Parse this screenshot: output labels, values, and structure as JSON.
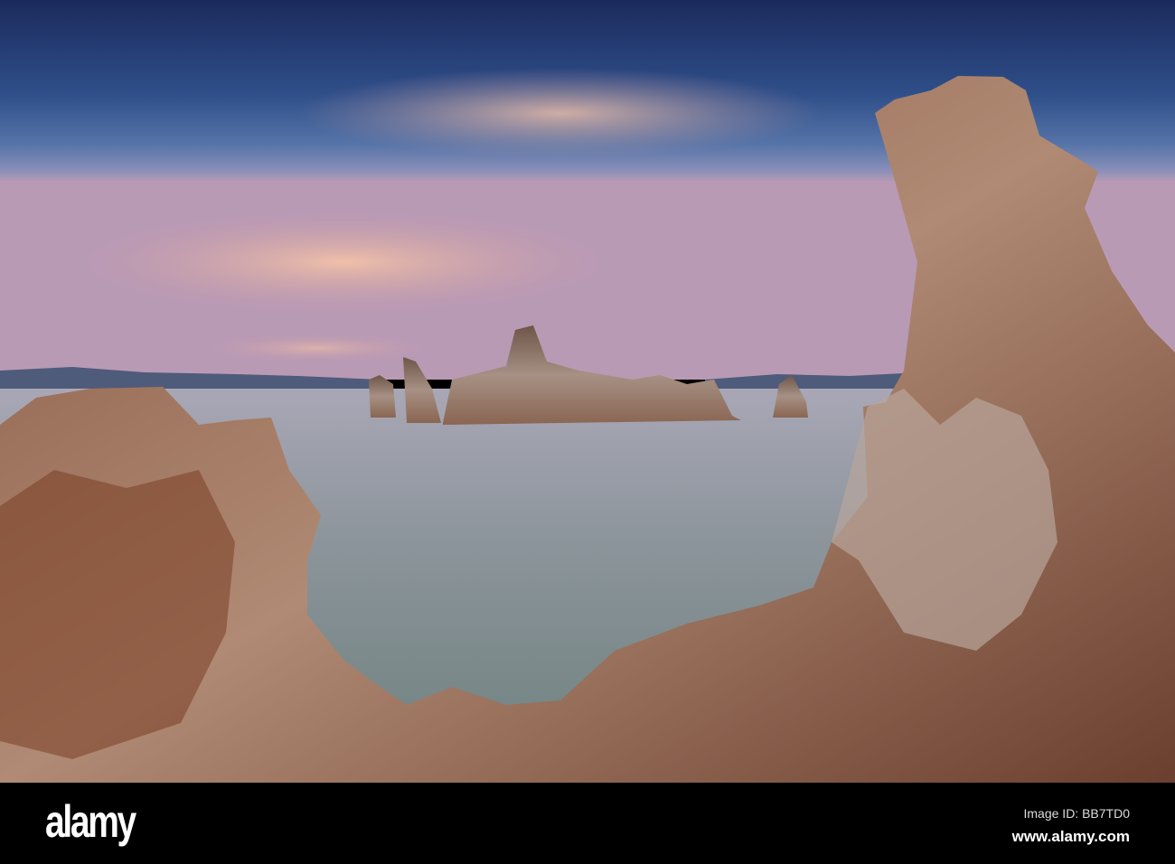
{
  "photo": {
    "subject": "tufa towers at lake at dusk"
  },
  "watermark": {
    "brand": "alamy"
  },
  "footer": {
    "logo": "alamy",
    "image_id": "Image ID: BB7TD0",
    "url": "www.alamy.com"
  }
}
